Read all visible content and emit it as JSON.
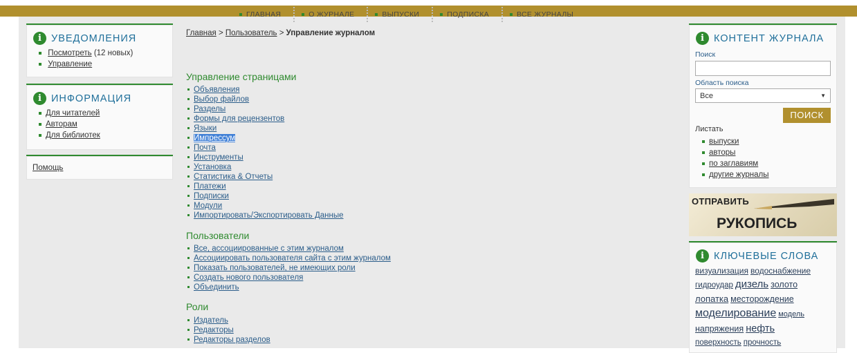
{
  "nav": {
    "items": [
      "ГЛАВНАЯ",
      "О ЖУРНАЛЕ",
      "ВЫПУСКИ",
      "ПОДПИСКА",
      "ВСЕ ЖУРНАЛЫ"
    ]
  },
  "notifications": {
    "title": "УВЕДОМЛЕНИЯ",
    "view_label": "Посмотреть",
    "view_count": "(12 новых)",
    "manage_label": "Управление"
  },
  "info": {
    "title": "ИНФОРМАЦИЯ",
    "items": [
      "Для читателей",
      "Авторам",
      "Для библиотек"
    ]
  },
  "help": {
    "label": "Помощь"
  },
  "breadcrumb": {
    "home": "Главная",
    "sep1": " > ",
    "user": "Пользователь",
    "sep2": " > ",
    "current": "Управление журналом"
  },
  "sections": {
    "pages": {
      "title": "Управление страницами",
      "items": [
        "Объявления",
        "Выбор файлов",
        "Разделы",
        "Формы для рецензентов",
        "Языки",
        "Импрессум",
        "Почта",
        "Инструменты",
        "Установка",
        "Статистика & Отчеты",
        "Платежи",
        "Подписки",
        "Модули",
        "Импортировать/Экспортировать Данные"
      ]
    },
    "users": {
      "title": "Пользователи",
      "items": [
        "Все, ассоциированные с этим журналом",
        "Ассоциировать пользователя сайта с этим журналом",
        "Показать пользователей, не имеющих роли",
        "Создать нового пользователя",
        "Объединить"
      ]
    },
    "roles": {
      "title": "Роли",
      "items": [
        "Издатель",
        "Редакторы",
        "Редакторы разделов"
      ]
    }
  },
  "journal_content": {
    "title": "КОНТЕНТ ЖУРНАЛА",
    "search_label": "Поиск",
    "search_value": "",
    "scope_label": "Область поиска",
    "scope_value": "Все",
    "search_button": "ПОИСК",
    "browse_label": "Листать",
    "browse_items": [
      "выпуски",
      "авторы",
      "по заглавиям",
      "другие журналы"
    ]
  },
  "banner": {
    "line1": "ОТПРАВИТЬ",
    "line2": "РУКОПИСЬ"
  },
  "keywords": {
    "title": "КЛЮЧЕВЫЕ СЛОВА",
    "words": [
      "визуализация",
      "водоснабжение",
      "гидроудар",
      "дизель",
      "золото",
      "лопатка",
      "месторождение",
      "моделирование",
      "модель",
      "напряжения",
      "нефть",
      "поверхность",
      "прочность"
    ]
  },
  "colors": {
    "topbar": "#b1902e",
    "accent_green": "#2f8a2f",
    "link_blue": "#2b5d8a",
    "selection": "#3f7fd6"
  },
  "icons": {
    "info": "info-icon",
    "dropdown": "chevron-down-icon",
    "bullet": "square-bullet-icon",
    "pen": "pen-icon"
  }
}
